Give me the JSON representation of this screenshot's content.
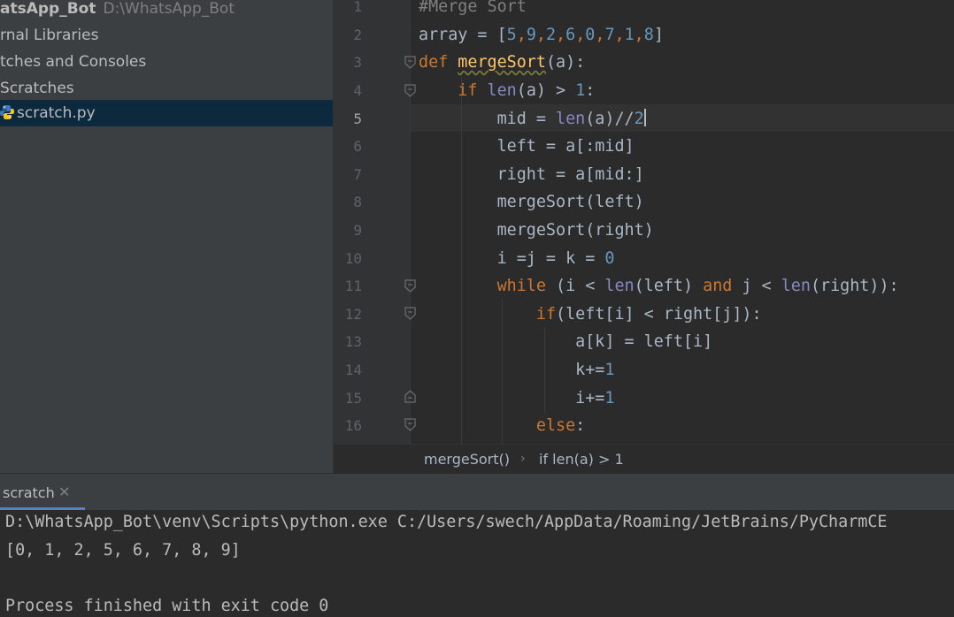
{
  "project_panel": {
    "root_name": "atsApp_Bot",
    "root_path": "D:\\WhatsApp_Bot",
    "items": [
      {
        "label": "rnal Libraries"
      },
      {
        "label": "tches and Consoles"
      },
      {
        "label": "Scratches"
      },
      {
        "label": "scratch.py",
        "icon": "python-file-icon",
        "selected": true
      }
    ]
  },
  "editor": {
    "current_line": 5,
    "line_numbers": [
      "1",
      "2",
      "3",
      "4",
      "5",
      "6",
      "7",
      "8",
      "9",
      "10",
      "11",
      "12",
      "13",
      "14",
      "15",
      "16"
    ],
    "lines": [
      "#Merge Sort",
      "array = [5,9,2,6,0,7,1,8]",
      "def mergeSort(a):",
      "    if len(a) > 1:",
      "        mid = len(a)//2",
      "        left = a[:mid]",
      "        right = a[mid:]",
      "        mergeSort(left)",
      "        mergeSort(right)",
      "        i =j = k = 0",
      "        while (i < len(left) and j < len(right)):",
      "            if(left[i] < right[j]):",
      "                a[k] = left[i]",
      "                k+=1",
      "                i+=1",
      "            else:"
    ],
    "colors": {
      "keyword": "#cc7832",
      "number": "#6897bb",
      "comment": "#808080",
      "function": "#ffc66d",
      "builtin": "#8888c6",
      "text": "#a9b7c6"
    }
  },
  "breadcrumb": {
    "items": [
      "mergeSort()",
      "if len(a) > 1"
    ],
    "separator": "›"
  },
  "run_panel": {
    "tab_label": "scratch",
    "close_glyph": "✕",
    "accent": "#4a88c7",
    "output_lines": [
      "D:\\WhatsApp_Bot\\venv\\Scripts\\python.exe C:/Users/swech/AppData/Roaming/JetBrains/PyCharmCE",
      "[0, 1, 2, 5, 6, 7, 8, 9]",
      "",
      "Process finished with exit code 0"
    ]
  }
}
